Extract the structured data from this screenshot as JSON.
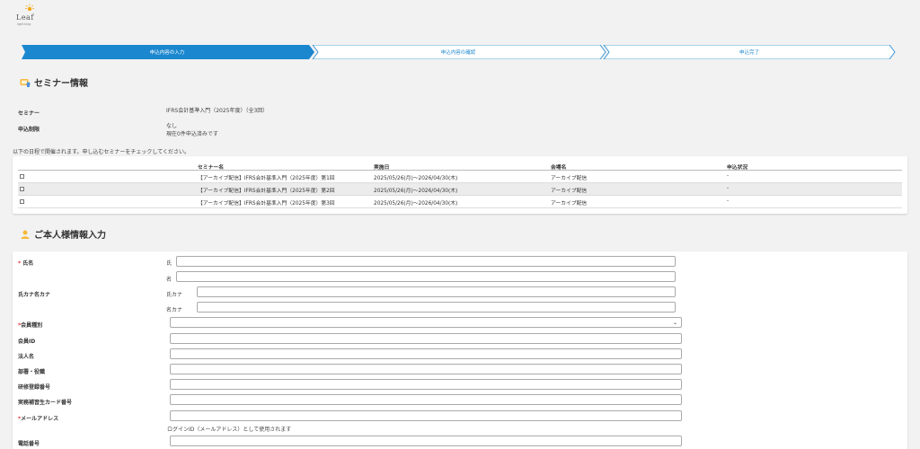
{
  "logo": {
    "word": "Leaf",
    "sub": "lightning",
    "sun_color": "#f3a712"
  },
  "steps": [
    {
      "label": "申込内容の入力",
      "active": true
    },
    {
      "label": "申込内容の確認",
      "active": false
    },
    {
      "label": "申込完了",
      "active": false
    }
  ],
  "colors": {
    "accent": "#1b87cf",
    "required": "#e8383d"
  },
  "seminar_section": {
    "title": "セミナー情報",
    "icon": "seminar-icon",
    "seminar_label": "セミナー",
    "seminar_value": "IFRS会計基準入門（2025年度）（全3回）",
    "limit_label": "申込制限",
    "limit_value_1": "なし",
    "limit_value_2": "現在0件申込済みです",
    "note": "以下の日程で開催されます。申し込むセミナーをチェックしてください。",
    "table": {
      "headers": [
        "セミナー名",
        "実施日",
        "会場名",
        "申込状況"
      ],
      "rows": [
        [
          "【アーカイブ配信】IFRS会計基準入門（2025年度）第1回",
          "2025/05/26(月)〜2026/04/30(木)",
          "アーカイブ配信",
          "-"
        ],
        [
          "【アーカイブ配信】IFRS会計基準入門（2025年度）第2回",
          "2025/05/26(月)〜2026/04/30(木)",
          "アーカイブ配信",
          "-"
        ],
        [
          "【アーカイブ配信】IFRS会計基準入門（2025年度）第3回",
          "2025/05/26(月)〜2026/04/30(木)",
          "アーカイブ配信",
          "-"
        ]
      ]
    }
  },
  "personal_section": {
    "title": "ご本人様情報入力",
    "icon": "person-icon",
    "required_mark": "*",
    "fields": {
      "name_label": "氏名",
      "last_name_sub": "氏",
      "first_name_sub": "名",
      "kana_label": "氏カナ名カナ",
      "last_kana_sub": "氏カナ",
      "first_kana_sub": "名カナ",
      "member_type_label": "会員種別",
      "member_type_value": "",
      "member_id_label": "会員ID",
      "corp_label": "法人名",
      "dept_label": "部署・役職",
      "training_label": "研修登録番号",
      "card_label": "実務補習生カード番号",
      "email_label": "メールアドレス",
      "email_hint": "ログインID（メールアドレス）として使用されます",
      "phone_label": "電話番号"
    }
  }
}
